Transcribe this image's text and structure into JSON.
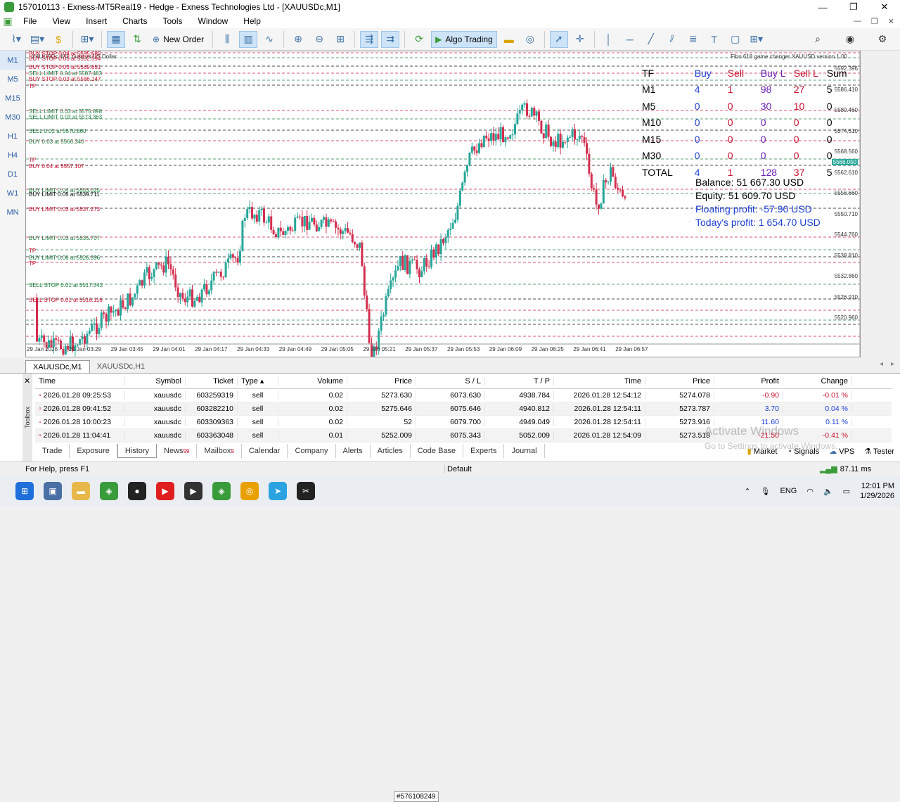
{
  "window": {
    "title": "157010113 - Exness-MT5Real19 - Hedge - Exness Technologies Ltd - [XAUUSDc,M1]",
    "controls": [
      "—",
      "❐",
      "✕"
    ]
  },
  "menu": [
    "File",
    "View",
    "Insert",
    "Charts",
    "Tools",
    "Window",
    "Help"
  ],
  "toolbar": {
    "new_order": "New Order",
    "algo_trading": "Algo Trading"
  },
  "timeframes": [
    "M1",
    "M5",
    "M15",
    "M30",
    "H1",
    "H4",
    "D1",
    "W1",
    "MN"
  ],
  "chart": {
    "symbol_caption": "XAUUSDc, M1:  Gold vs US Dollar",
    "indicator_caption": "Fibo 618 game changer XAUUSD version 1.00",
    "current_price": "5566.050",
    "price_labels": [
      "5592.396",
      "5586.410",
      "5580.460",
      "5574.510",
      "5568.560",
      "5562.610",
      "5556.660",
      "5550.710",
      "5544.760",
      "5538.810",
      "5532.860",
      "5526.910",
      "5520.960"
    ],
    "time_labels": [
      "29 Jan 2026",
      "29 Jan 03:29",
      "29 Jan 03:45",
      "29 Jan 04:01",
      "29 Jan 04:17",
      "29 Jan 04:33",
      "29 Jan 04:49",
      "29 Jan 05:05",
      "29 Jan 05:21",
      "29 Jan 05:37",
      "29 Jan 05:53",
      "29 Jan 06:09",
      "29 Jan 06:25",
      "29 Jan 06:41",
      "29 Jan 06:57"
    ],
    "order_lines": [
      {
        "text": "BUY STOP 0.04 at 5595.685",
        "color": "#c8102e"
      },
      {
        "text": "BUY STOP 0.03 at 5592.594",
        "color": "#c8102e"
      },
      {
        "text": "BUY STOP 0.03 at 5589.851",
        "color": "#c8102e"
      },
      {
        "text": "SELL LIMIT 0.04 at 5587.483",
        "color": "#1b7a3c"
      },
      {
        "text": "BUY STOP 0.03 at 5586.147",
        "color": "#c8102e"
      },
      {
        "text": "TP",
        "color": "#c8102e"
      },
      {
        "text": "SELL LIMIT 0.03 at 5575.898",
        "color": "#1b7a3c"
      },
      {
        "text": "SELL LIMIT 0.03 at 5573.363",
        "color": "#1b7a3c"
      },
      {
        "text": "SELL 0.02 at 5570.860",
        "color": "#1b7a3c"
      },
      {
        "text": "BUY 0.03 at 5566.340",
        "color": "#1b7a3c"
      },
      {
        "text": "TP",
        "color": "#c8102e"
      },
      {
        "text": "BUY 0.04 at 5557.107",
        "color": "#c8102e"
      },
      {
        "text": "BUY LIMIT 0.04 at 5553.025",
        "color": "#1b7a3c"
      },
      {
        "text": "BUY LIMIT 0.05 at 5539.711",
        "color": "#000000"
      },
      {
        "text": "BUY LIMIT 0.03 at 5537.273",
        "color": "#c8102e"
      },
      {
        "text": "BUY LIMIT 0.03 at 5535.707",
        "color": "#1b7a3c"
      },
      {
        "text": "TP",
        "color": "#c8102e"
      },
      {
        "text": "BUY LIMIT 0.06 at 5526.396",
        "color": "#1b7a3c"
      },
      {
        "text": "TP",
        "color": "#c8102e"
      },
      {
        "text": "SELL STOP 0.01 at 5517.542",
        "color": "#1b7a3c"
      },
      {
        "text": "SELL STOP 0.01 at 5516.116",
        "color": "#c8102e"
      }
    ],
    "stats_header": [
      "TF",
      "Buy",
      "Sell",
      "Buy L",
      "Sell L",
      "Sum"
    ],
    "stats_rows": [
      [
        "M1",
        "4",
        "1",
        "98",
        "27",
        "5"
      ],
      [
        "M5",
        "0",
        "0",
        "30",
        "10",
        "0"
      ],
      [
        "M10",
        "0",
        "0",
        "0",
        "0",
        "0"
      ],
      [
        "M15",
        "0",
        "0",
        "0",
        "0",
        "0"
      ],
      [
        "M30",
        "0",
        "0",
        "0",
        "0",
        "0"
      ],
      [
        "TOTAL",
        "4",
        "1",
        "128",
        "37",
        "5"
      ]
    ],
    "balance": "Balance:    51 667.30 USD",
    "equity": "Equity:    51 609.70 USD",
    "floating": "Floating profit:    -57.90 USD",
    "today": "Today's profit:    1 654.70 USD"
  },
  "chart_tabs": [
    "XAUUSDc,M1",
    "XAUUSDc,H1"
  ],
  "history": {
    "columns": [
      "Time",
      "Symbol",
      "Ticket",
      "Type",
      "Volume",
      "Price",
      "S / L",
      "T / P",
      "Time",
      "Price",
      "Profit",
      "Change"
    ],
    "rows": [
      [
        "2026.01.28 09:25:53",
        "xauusdc",
        "603259319",
        "sell",
        "0.02",
        "5273.630",
        "6073.630",
        "4938.784",
        "2026.01.28 12:54:12",
        "5274.078",
        "-0.90",
        "-0.01 %"
      ],
      [
        "2026.01.28 09:41:52",
        "xauusdc",
        "603282210",
        "sell",
        "0.02",
        "5275.646",
        "6075.646",
        "4940.812",
        "2026.01.28 12:54:11",
        "5273.787",
        "3.70",
        "0.04 %"
      ],
      [
        "2026.01.28 10:00:23",
        "xauusdc",
        "603309363",
        "sell",
        "0.02",
        "52",
        "6079.700",
        "4949.049",
        "2026.01.28 12:54:11",
        "5273.916",
        "11.60",
        "0.11 %"
      ],
      [
        "2026.01.28 11:04:41",
        "xauusdc",
        "603363048",
        "sell",
        "0.01",
        "5252.009",
        "6075.343",
        "5052.009",
        "2026.01.28 12:54:09",
        "5273.518",
        "-21.50",
        "-0.41 %"
      ]
    ],
    "tooltip": "#576108249"
  },
  "toolbox_label": "Toolbox",
  "bottom_tabs": [
    "Trade",
    "Exposure",
    "History",
    "News",
    "Mailbox",
    "Calendar",
    "Company",
    "Alerts",
    "Articles",
    "Code Base",
    "Experts",
    "Journal"
  ],
  "news_badge": "99",
  "mail_badge": "9",
  "right_tools": [
    "Market",
    "Signals",
    "VPS",
    "Tester"
  ],
  "status": {
    "help": "For Help, press F1",
    "profile": "Default",
    "ping": "87.11 ms"
  },
  "watermark": {
    "line1": "Activate Windows",
    "line2": "Go to Settings to activate Windows."
  },
  "tray": {
    "lang": "ENG",
    "time": "12:01 PM",
    "date": "1/29/2026"
  }
}
